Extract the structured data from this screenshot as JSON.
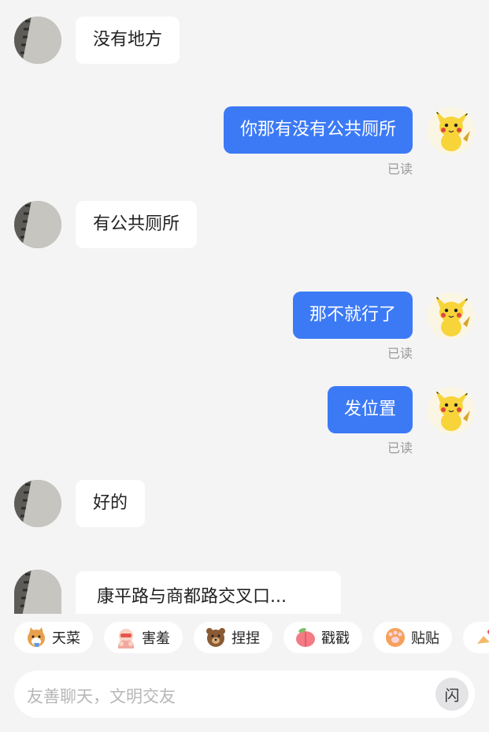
{
  "messages": [
    {
      "side": "in",
      "text": "没有地方"
    },
    {
      "side": "out",
      "text": "你那有没有公共厕所",
      "status": "已读"
    },
    {
      "side": "in",
      "text": "有公共厕所"
    },
    {
      "side": "out",
      "text": "那不就行了",
      "status": "已读"
    },
    {
      "side": "out",
      "text": "发位置",
      "status": "已读"
    },
    {
      "side": "in",
      "text": "好的"
    },
    {
      "side": "in",
      "text": "康平路与商都路交叉口..."
    }
  ],
  "quick_replies": [
    {
      "label": "天菜",
      "icon": "corgi-sticker-icon",
      "color": "#e8a04c"
    },
    {
      "label": "害羞",
      "icon": "shy-face-sticker-icon",
      "color": "#f2a7a0"
    },
    {
      "label": "捏捏",
      "icon": "bear-sticker-icon",
      "color": "#8a5a34"
    },
    {
      "label": "戳戳",
      "icon": "peach-sticker-icon",
      "color": "#f47a84"
    },
    {
      "label": "贴贴",
      "icon": "cat-paw-sticker-icon",
      "color": "#f5a15c"
    }
  ],
  "input": {
    "placeholder": "友善聊天，文明交友",
    "flash_label": "闪"
  },
  "colors": {
    "outgoing_bubble": "#3c7af5",
    "incoming_bubble": "#ffffff",
    "background": "#f4f4f5"
  }
}
